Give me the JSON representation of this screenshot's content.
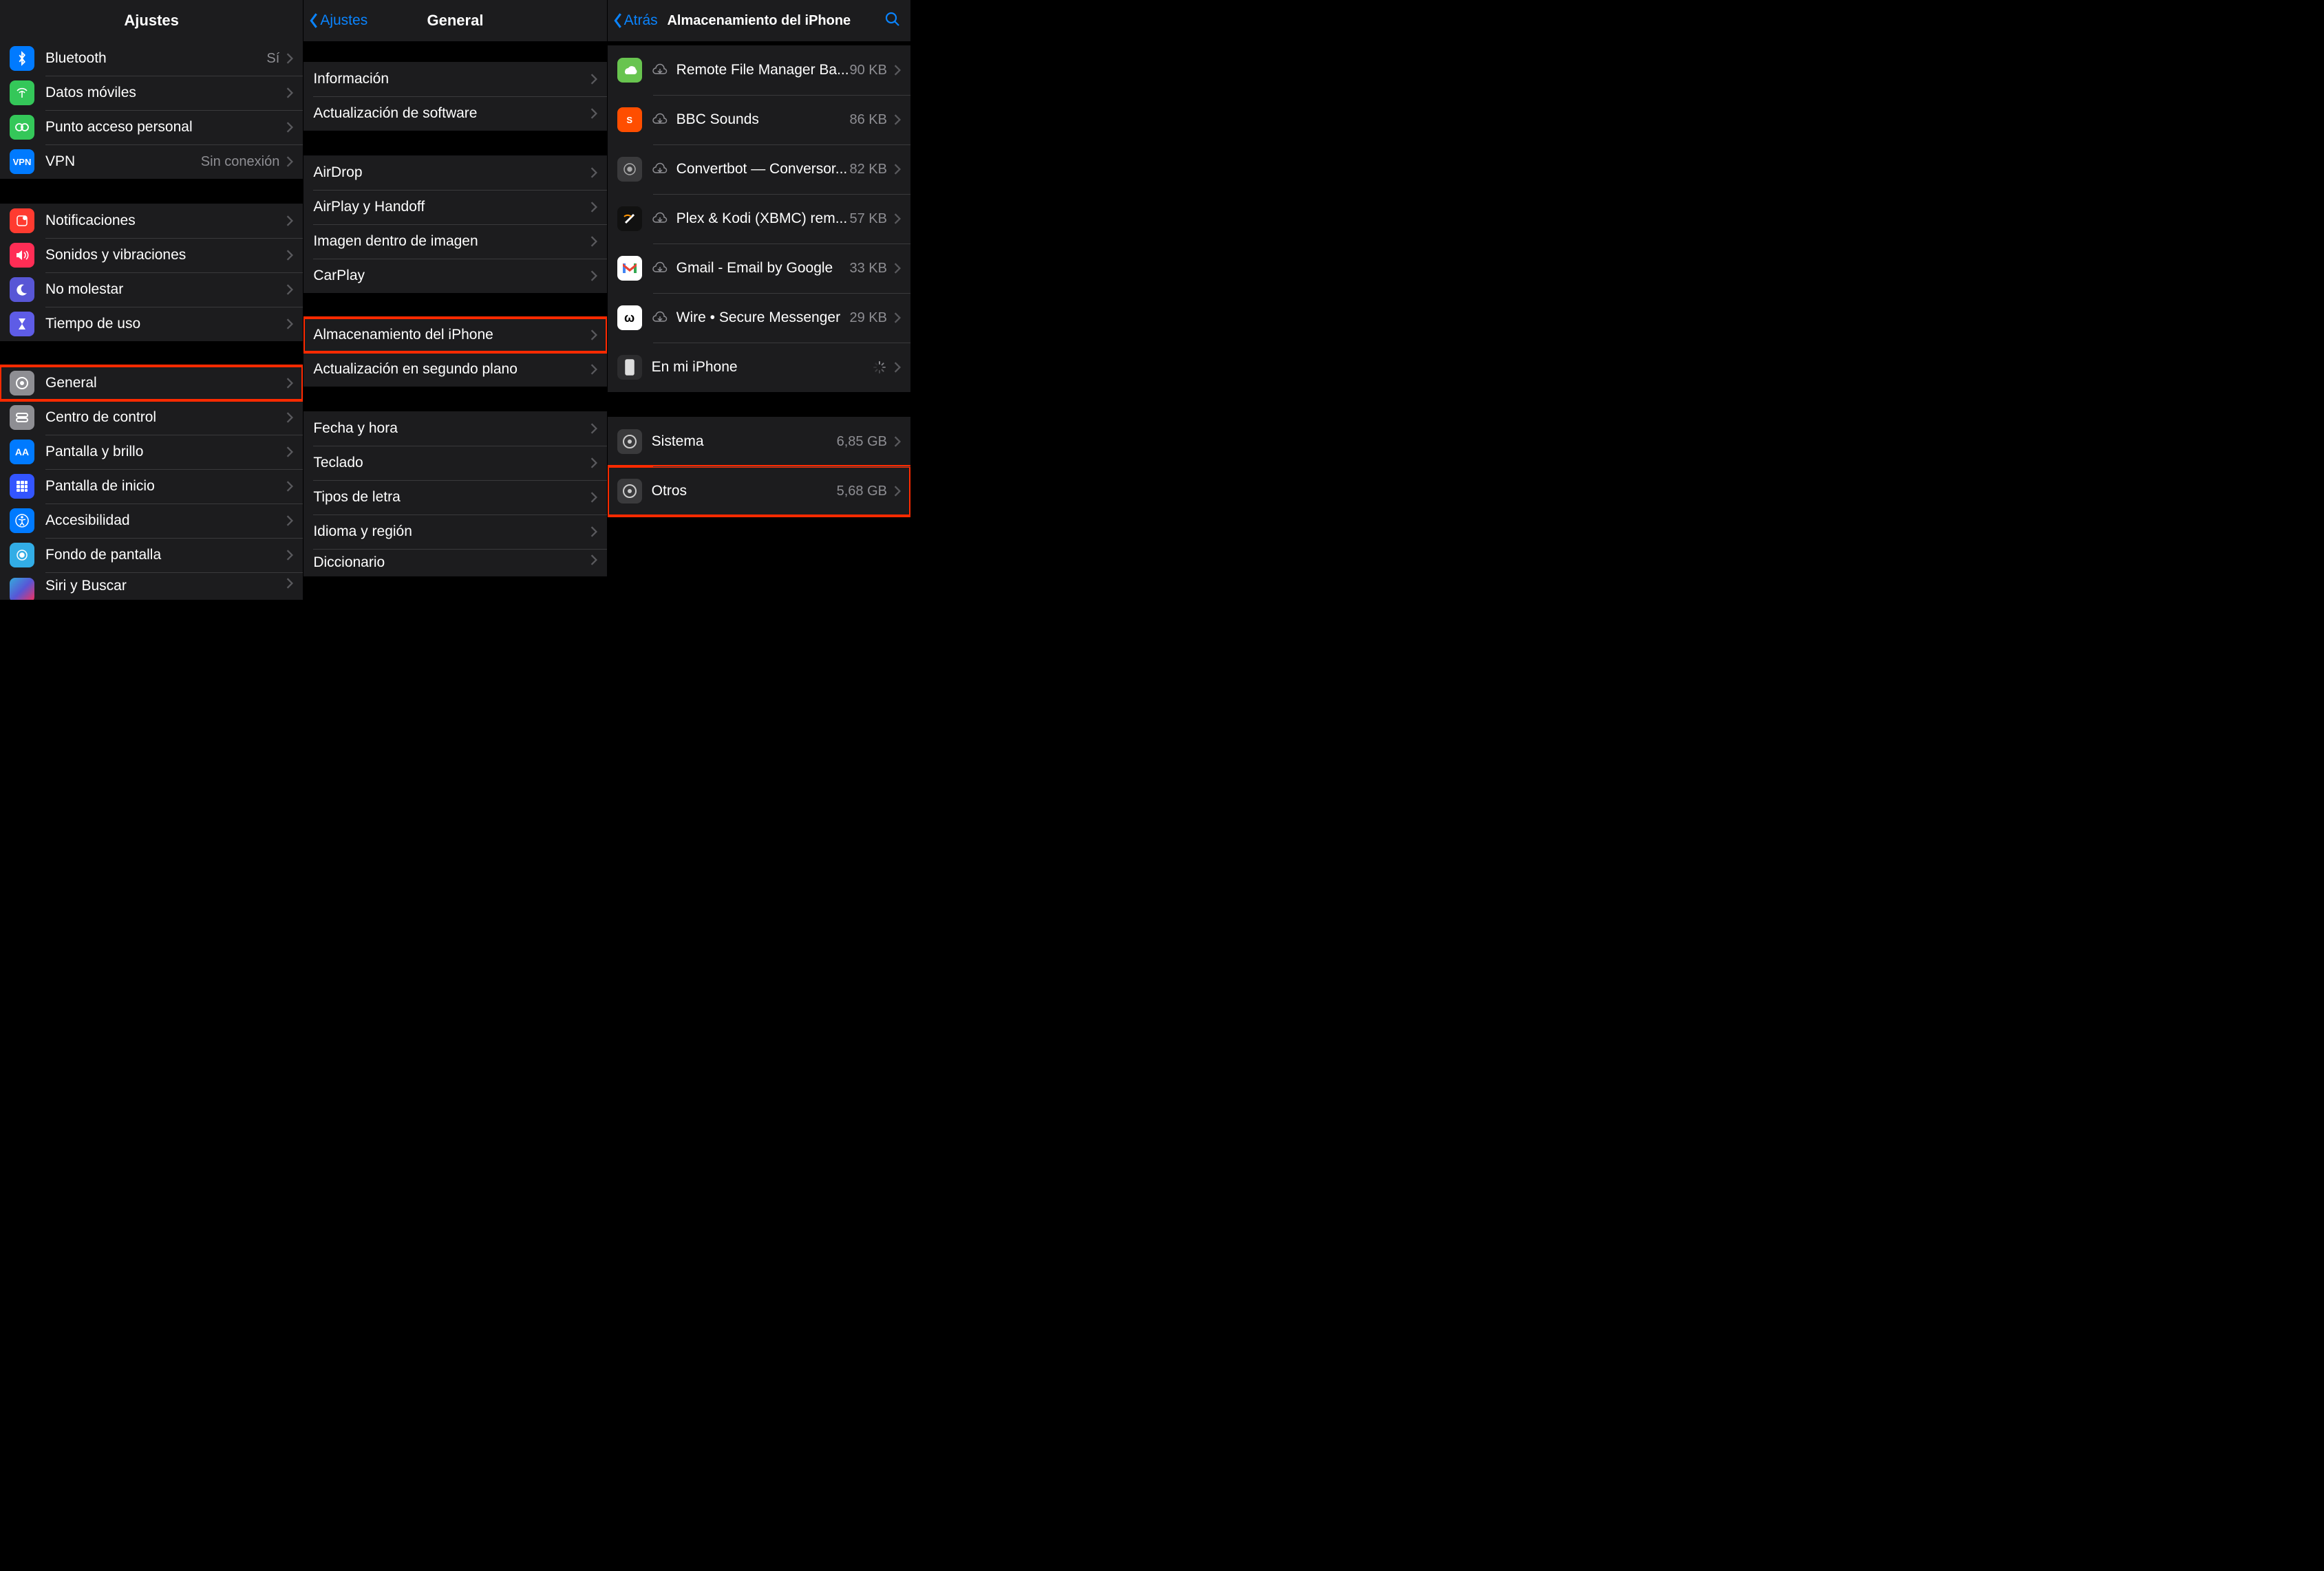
{
  "panel_a": {
    "title": "Ajustes",
    "groups": [
      [
        {
          "icon": "bluetooth",
          "label": "Bluetooth",
          "detail": "Sí"
        },
        {
          "icon": "antenna",
          "label": "Datos móviles"
        },
        {
          "icon": "hotspot",
          "label": "Punto acceso personal"
        },
        {
          "icon": "vpn",
          "label": "VPN",
          "detail": "Sin conexión"
        }
      ],
      [
        {
          "icon": "notif",
          "label": "Notificaciones"
        },
        {
          "icon": "sound",
          "label": "Sonidos y vibraciones"
        },
        {
          "icon": "moon",
          "label": "No molestar"
        },
        {
          "icon": "hourglass",
          "label": "Tiempo de uso"
        }
      ],
      [
        {
          "icon": "gear",
          "label": "General",
          "highlight": true
        },
        {
          "icon": "control",
          "label": "Centro de control"
        },
        {
          "icon": "display",
          "label": "Pantalla y brillo"
        },
        {
          "icon": "home",
          "label": "Pantalla de inicio"
        },
        {
          "icon": "access",
          "label": "Accesibilidad"
        },
        {
          "icon": "wallpaper",
          "label": "Fondo de pantalla"
        },
        {
          "icon": "siri",
          "label": "Siri y Buscar",
          "partial": true
        }
      ]
    ]
  },
  "panel_b": {
    "back": "Ajustes",
    "title": "General",
    "groups": [
      [
        {
          "label": "Información"
        },
        {
          "label": "Actualización de software"
        }
      ],
      [
        {
          "label": "AirDrop"
        },
        {
          "label": "AirPlay y Handoff"
        },
        {
          "label": "Imagen dentro de imagen"
        },
        {
          "label": "CarPlay"
        }
      ],
      [
        {
          "label": "Almacenamiento del iPhone",
          "highlight": true
        },
        {
          "label": "Actualización en segundo plano"
        }
      ],
      [
        {
          "label": "Fecha y hora"
        },
        {
          "label": "Teclado"
        },
        {
          "label": "Tipos de letra"
        },
        {
          "label": "Idioma y región"
        },
        {
          "label": "Diccionario",
          "partial": true
        }
      ]
    ]
  },
  "panel_c": {
    "back": "Atrás",
    "title": "Almacenamiento del iPhone",
    "apps": [
      {
        "icon": "green",
        "cloud": true,
        "label": "Remote File Manager Ba...",
        "detail": "90 KB"
      },
      {
        "icon": "orange-s",
        "cloud": true,
        "label": "BBC Sounds",
        "detail": "86 KB"
      },
      {
        "icon": "convert",
        "cloud": true,
        "label": "Convertbot — Conversor...",
        "detail": "82 KB"
      },
      {
        "icon": "plex",
        "cloud": true,
        "label": "Plex & Kodi (XBMC) rem...",
        "detail": "57 KB"
      },
      {
        "icon": "gmail",
        "cloud": true,
        "label": "Gmail - Email by Google",
        "detail": "33 KB"
      },
      {
        "icon": "wire",
        "cloud": true,
        "label": "Wire • Secure Messenger",
        "detail": "29 KB"
      },
      {
        "icon": "iphone",
        "label": "En mi iPhone",
        "spinner": true
      }
    ],
    "system": [
      {
        "icon": "gear-light",
        "label": "Sistema",
        "detail": "6,85 GB"
      },
      {
        "icon": "gear-light",
        "label": "Otros",
        "detail": "5,68 GB",
        "highlight": true
      }
    ]
  }
}
